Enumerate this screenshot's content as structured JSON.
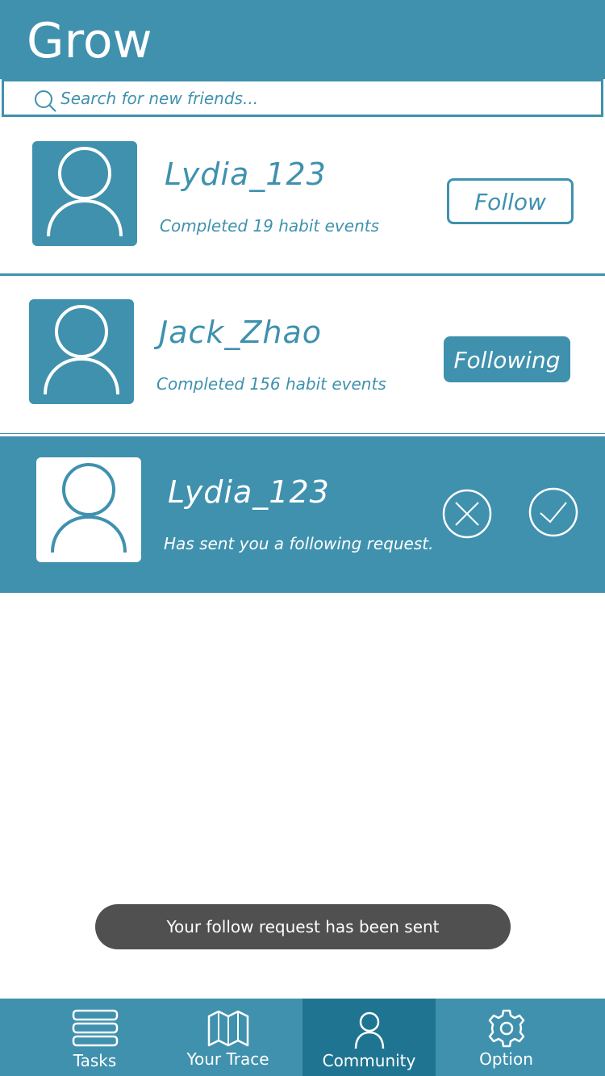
{
  "header": {
    "title": "Grow"
  },
  "search": {
    "placeholder": "Search for new friends..."
  },
  "users": [
    {
      "name": "Lydia_123",
      "subtitle": "Completed 19 habit events",
      "button_label": "Follow",
      "button_state": "follow"
    },
    {
      "name": "Jack_Zhao",
      "subtitle": "Completed 156 habit events",
      "button_label": "Following",
      "button_state": "following"
    }
  ],
  "request": {
    "name": "Lydia_123",
    "message": "Has sent you a following request."
  },
  "toast": {
    "text": "Your follow request has been sent"
  },
  "tabs": [
    {
      "label": "Tasks",
      "icon": "tasks-icon",
      "active": false
    },
    {
      "label": "Your Trace",
      "icon": "map-icon",
      "active": false
    },
    {
      "label": "Community",
      "icon": "person-icon",
      "active": true
    },
    {
      "label": "Option",
      "icon": "gear-icon",
      "active": false
    }
  ],
  "colors": {
    "primary": "#3f91ae",
    "active_tab": "#1f7591",
    "toast_bg": "#505050"
  }
}
